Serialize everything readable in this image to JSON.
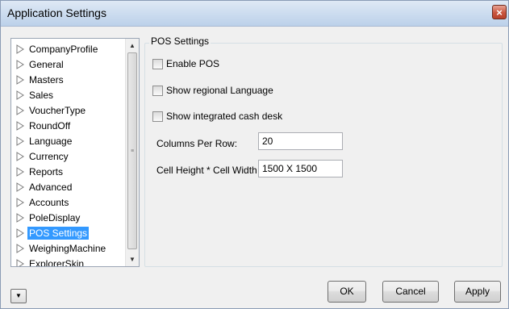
{
  "window": {
    "title": "Application Settings",
    "close_glyph": "×"
  },
  "tree": {
    "items": [
      {
        "label": "CompanyProfile"
      },
      {
        "label": "General"
      },
      {
        "label": "Masters"
      },
      {
        "label": "Sales"
      },
      {
        "label": "VoucherType"
      },
      {
        "label": "RoundOff"
      },
      {
        "label": "Language"
      },
      {
        "label": "Currency"
      },
      {
        "label": "Reports"
      },
      {
        "label": "Advanced"
      },
      {
        "label": "Accounts"
      },
      {
        "label": "PoleDisplay"
      },
      {
        "label": "POS Settings",
        "selected": true
      },
      {
        "label": "WeighingMachine"
      },
      {
        "label": "ExplorerSkin"
      }
    ]
  },
  "pos_settings": {
    "group_title": "POS Settings",
    "enable_pos": {
      "label": "Enable POS",
      "checked": false
    },
    "show_regional_language": {
      "label": "Show regional Language",
      "checked": false
    },
    "show_integrated_cash_desk": {
      "label": "Show integrated cash desk",
      "checked": false
    },
    "columns_per_row": {
      "label": "Columns Per Row:",
      "value": "20"
    },
    "cell_size": {
      "label": "Cell Height * Cell Width",
      "value": "1500 X 1500"
    }
  },
  "buttons": {
    "ok": "OK",
    "cancel": "Cancel",
    "apply": "Apply"
  },
  "icons": {
    "tree_arrow": "triangle-right-outline-icon",
    "dropdown": "chevron-down-icon",
    "scroll_up": "scroll-up-icon",
    "scroll_down": "scroll-down-icon",
    "close": "close-icon"
  },
  "colors": {
    "selection": "#3399ff",
    "close_button": "#c9553e"
  }
}
